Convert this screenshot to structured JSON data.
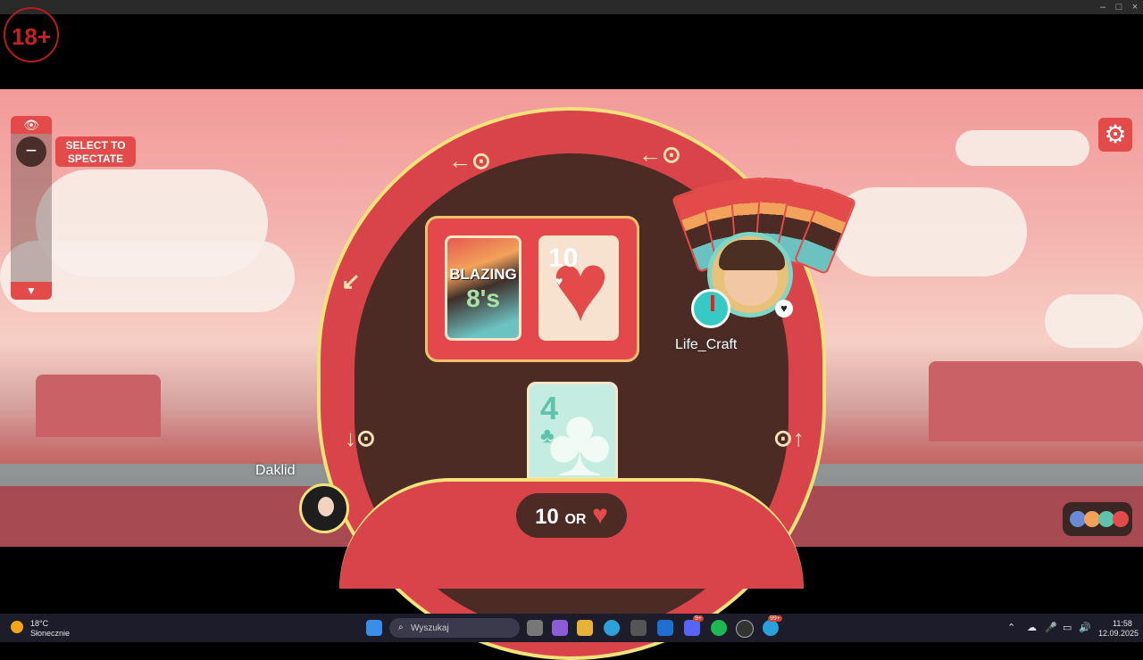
{
  "age_badge": "18+",
  "spectate": {
    "label": "SELECT TO SPECTATE",
    "eye_icon": "eye-icon",
    "minus": "−",
    "down": "▼"
  },
  "settings": {
    "icon": "gear-icon",
    "glyph": "⚙"
  },
  "deck": {
    "logo_top": "BLAZING",
    "logo_bottom": "8's"
  },
  "pile_top_card": {
    "rank": "10",
    "suit": "♥"
  },
  "player_hand_card": {
    "rank": "4",
    "suit": "♣"
  },
  "call_button": {
    "rank": "10",
    "or": "OR",
    "suit": "♥"
  },
  "opponent": {
    "name": "Life_Craft",
    "card_count": 6
  },
  "me": {
    "name": "Daklid"
  },
  "colors": {
    "table": "#d9434a",
    "border": "#f2e27a",
    "felt": "#4b2b24",
    "accent": "#e24b4a"
  },
  "color_dots": [
    "#6a8ad6",
    "#f2a25a",
    "#5fc3aa",
    "#e24b4a"
  ],
  "taskbar": {
    "weather_temp": "18°C",
    "weather_desc": "Słonecznie",
    "search_placeholder": "Wyszukaj",
    "time": "11:58",
    "date": "12.09.2025",
    "discord_badge": "9+",
    "telegram_badge": "99+"
  }
}
